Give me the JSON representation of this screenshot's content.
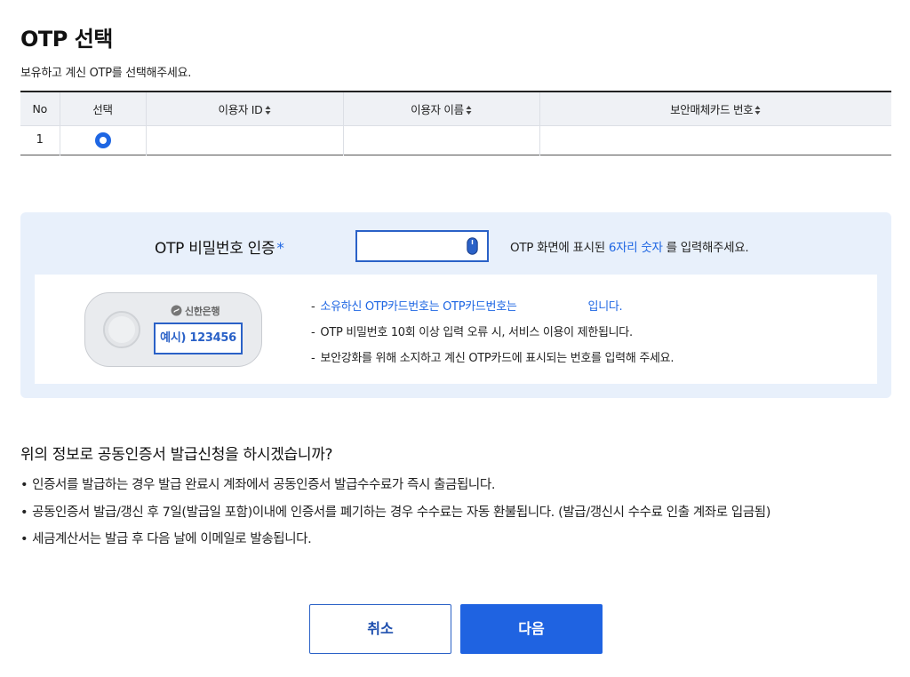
{
  "header": {
    "title": "OTP 선택",
    "subtitle": "보유하고 계신 OTP를 선택해주세요."
  },
  "table": {
    "columns": [
      "No",
      "선택",
      "이용자 ID",
      "이용자 이름",
      "보안매체카드 번호"
    ],
    "rows": [
      {
        "no": "1",
        "selected": true,
        "user_id": "",
        "user_name": "",
        "card_no": ""
      }
    ]
  },
  "otp_auth": {
    "label": "OTP 비밀번호 인증",
    "required_mark": "*",
    "input_value": "",
    "hint_prefix": "OTP 화면에 표시된",
    "hint_highlight": "6자리 숫자",
    "hint_suffix": "를 입력해주세요.",
    "card": {
      "brand": "신한은행",
      "example": "예시) 123456"
    },
    "notes": [
      {
        "dash": "-",
        "text_a": "소유하신 OTP카드번호는 OTP카드번호는",
        "text_b": "입니다."
      },
      {
        "dash": "-",
        "text": "OTP 비밀번호 10회 이상 입력 오류 시, 서비스 이용이 제한됩니다."
      },
      {
        "dash": "-",
        "text": "보안강화를 위해 소지하고 계신 OTP카드에 표시되는 번호를 입력해 주세요."
      }
    ]
  },
  "confirm": {
    "question": "위의 정보로 공동인증서 발급신청을 하시겠습니까?",
    "bullets": [
      "인증서를 발급하는 경우 발급 완료시 계좌에서 공동인증서 발급수수료가 즉시 출금됩니다.",
      "공동인증서 발급/갱신 후 7일(발급일 포함)이내에 인증서를 폐기하는 경우 수수료는 자동 환불됩니다. (발급/갱신시 수수료 인출 계좌로 입금됨)",
      "세금계산서는 발급 후 다음 날에 이메일로 발송됩니다."
    ]
  },
  "buttons": {
    "cancel": "취소",
    "next": "다음"
  },
  "colors": {
    "accent": "#1e66e3",
    "panel_bg": "#e8f0fb",
    "header_bg": "#eff1f5"
  }
}
